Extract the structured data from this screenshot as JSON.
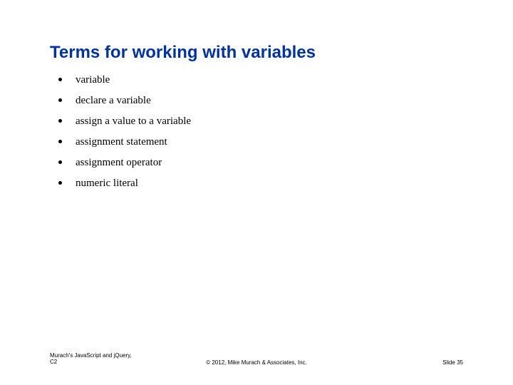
{
  "title": "Terms for working with variables",
  "bullets": [
    "variable",
    "declare a variable",
    "assign a value to a variable",
    "assignment statement",
    "assignment operator",
    "numeric literal"
  ],
  "footer": {
    "left_line1": "Murach's JavaScript and jQuery,",
    "left_line2": "C2",
    "center": "© 2012, Mike Murach & Associates, Inc.",
    "right": "Slide 35"
  }
}
